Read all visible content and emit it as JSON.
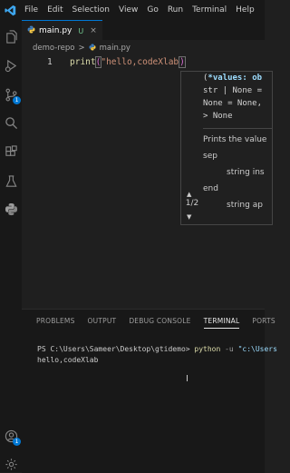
{
  "menubar": {
    "items": [
      "File",
      "Edit",
      "Selection",
      "View",
      "Go",
      "Run",
      "Terminal",
      "Help"
    ]
  },
  "activity_bar": {
    "icons": [
      "explorer-icon",
      "search-icon",
      "source-control-icon",
      "run-debug-icon",
      "extensions-icon",
      "testing-icon",
      "python-icon",
      "account-icon",
      "settings-icon"
    ],
    "source_control_badge": "1",
    "settings_badge": "1"
  },
  "tab": {
    "label": "main.py",
    "modified_marker": "U",
    "close_glyph": "×"
  },
  "breadcrumb": {
    "folder": "demo-repo",
    "separator": ">",
    "file": "main.py"
  },
  "editor": {
    "line_number": "1",
    "code_fn": "print",
    "code_open": "(",
    "code_str": "\"hello,codeXlab",
    "code_close": ")"
  },
  "hover": {
    "sig_line1_open": "(",
    "sig_line1_param": "*values: ob",
    "sig_line2": "str | None =",
    "sig_line3": "None = None,",
    "sig_line4": "> None",
    "doc_summary": "Prints the value",
    "param1_name": "sep",
    "param1_desc": "string ins",
    "param2_name": "end",
    "param2_desc": "string ap",
    "overload": "1/2"
  },
  "panel": {
    "tabs": [
      "PROBLEMS",
      "OUTPUT",
      "DEBUG CONSOLE",
      "TERMINAL",
      "PORTS"
    ],
    "active_tab": "TERMINAL"
  },
  "terminal": {
    "prompt": "PS C:\\Users\\Sameer\\Desktop\\gtidemo> ",
    "command": "python",
    "flag": " -u ",
    "arg": "\"c:\\Users",
    "output": "hello,codeXlab"
  },
  "colors": {
    "accent": "#0078d4",
    "background": "#1f1f1f",
    "chrome": "#181818"
  }
}
